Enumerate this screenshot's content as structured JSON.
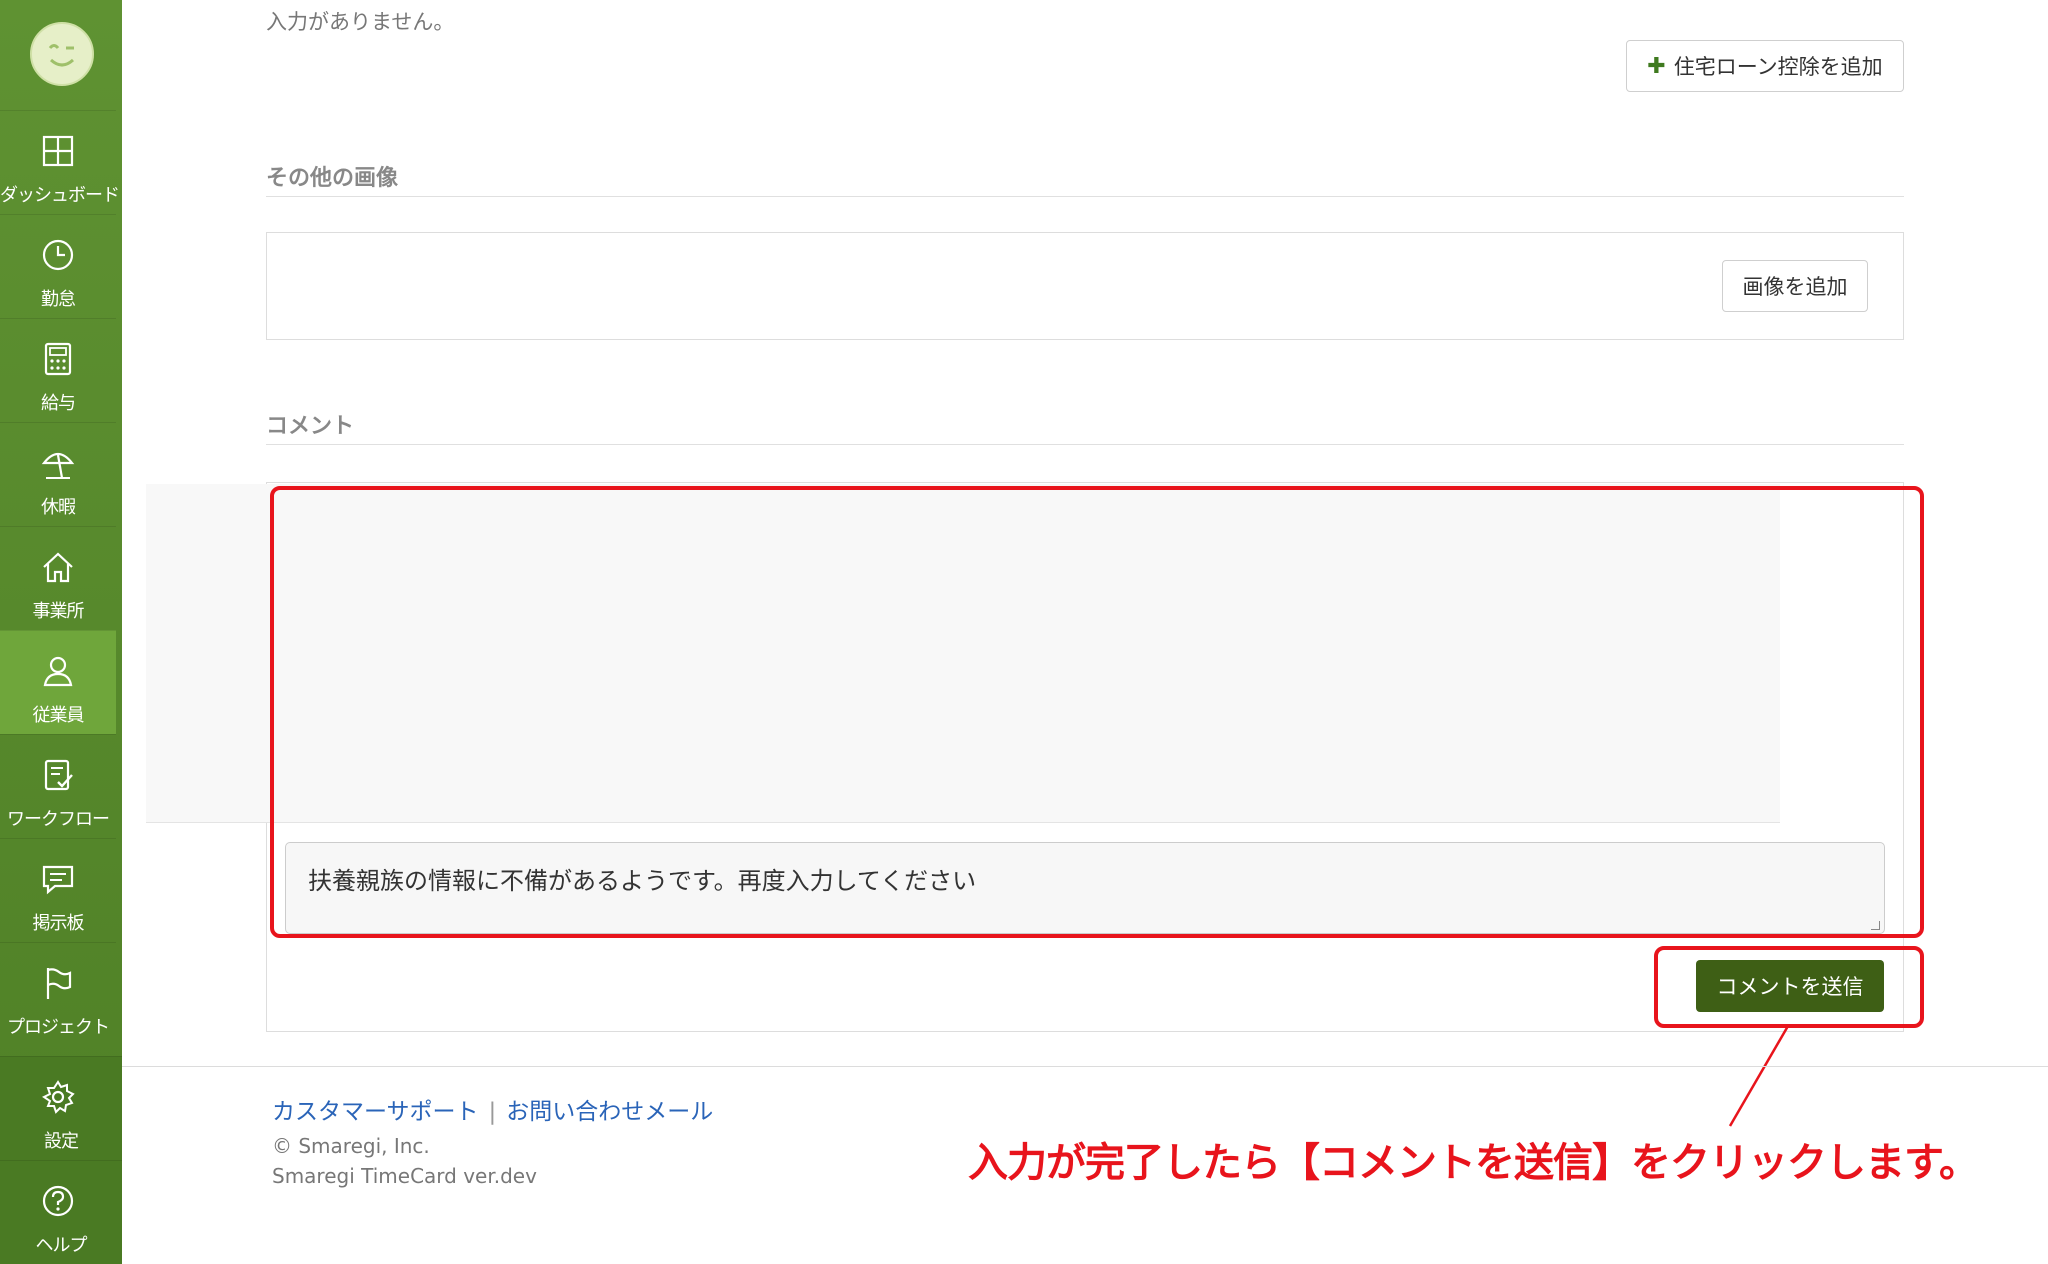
{
  "sidebar": {
    "items": [
      {
        "label": "ダッシュボード",
        "icon": "dashboard-icon",
        "active": false
      },
      {
        "label": "勤怠",
        "icon": "clock-icon",
        "active": false
      },
      {
        "label": "給与",
        "icon": "calculator-icon",
        "active": false
      },
      {
        "label": "休暇",
        "icon": "parasol-icon",
        "active": false
      },
      {
        "label": "事業所",
        "icon": "home-icon",
        "active": false
      },
      {
        "label": "従業員",
        "icon": "person-icon",
        "active": true
      },
      {
        "label": "ワークフロー",
        "icon": "checklist-icon",
        "active": false
      },
      {
        "label": "掲示板",
        "icon": "chat-icon",
        "active": false
      },
      {
        "label": "プロジェクト",
        "icon": "flag-icon",
        "active": false
      }
    ],
    "bottom": [
      {
        "label": "設定",
        "icon": "gear-icon"
      },
      {
        "label": "ヘルプ",
        "icon": "help-icon"
      }
    ]
  },
  "main": {
    "no_input_text": "入力がありません。",
    "add_loan_button": "住宅ローン控除を追加",
    "other_images_title": "その他の画像",
    "add_image_button": "画像を追加",
    "comment_title": "コメント",
    "comment_input_value": "扶養親族の情報に不備があるようです。再度入力してください",
    "send_comment_button": "コメントを送信"
  },
  "annotation": {
    "callout_text": "入力が完了したら【コメントを送信】をクリックします。",
    "color": "#e8141c"
  },
  "footer": {
    "link_support": "カスタマーサポート",
    "link_separator": "|",
    "link_mail": "お問い合わせメール",
    "copyright": "© Smaregi, Inc.",
    "version": "Smaregi TimeCard ver.dev"
  },
  "colors": {
    "sidebar": "#5f9232",
    "sidebar_active": "#6fa63b",
    "primary_button": "#3e5f15",
    "link": "#2a64b8"
  }
}
